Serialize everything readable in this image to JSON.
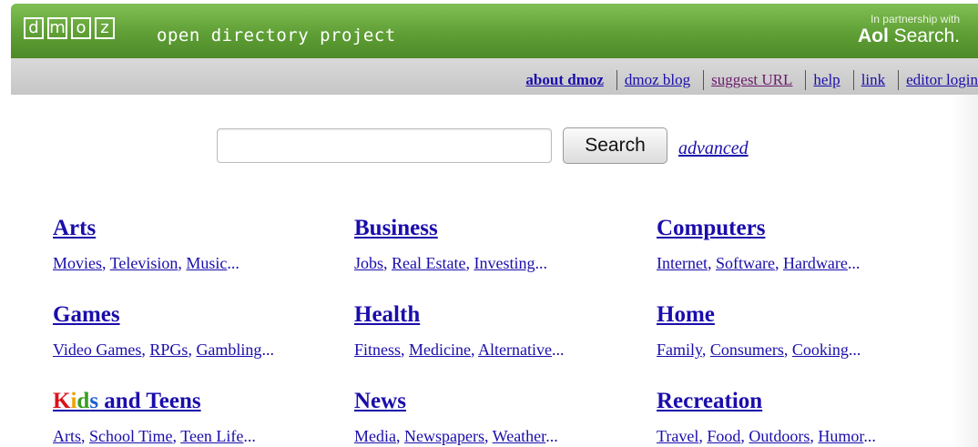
{
  "header": {
    "logo_letters": [
      "d",
      "m",
      "o",
      "z"
    ],
    "tagline": "open directory project",
    "partner_prefix": "In partnership with",
    "partner_brand_bold": "Aol",
    "partner_brand_rest": " Search."
  },
  "nav": {
    "items": [
      {
        "label": "about dmoz"
      },
      {
        "label": "dmoz blog"
      },
      {
        "label": "suggest URL"
      },
      {
        "label": "help"
      },
      {
        "label": "link"
      },
      {
        "label": "editor login"
      }
    ]
  },
  "search": {
    "value": "",
    "button_label": "Search",
    "advanced_label": "advanced"
  },
  "categories": [
    {
      "title": "Arts",
      "subs": [
        "Movies",
        "Television",
        "Music"
      ]
    },
    {
      "title": "Business",
      "subs": [
        "Jobs",
        "Real Estate",
        "Investing"
      ]
    },
    {
      "title": "Computers",
      "subs": [
        "Internet",
        "Software",
        "Hardware"
      ]
    },
    {
      "title": "Games",
      "subs": [
        "Video Games",
        "RPGs",
        "Gambling"
      ]
    },
    {
      "title": "Health",
      "subs": [
        "Fitness",
        "Medicine",
        "Alternative"
      ]
    },
    {
      "title": "Home",
      "subs": [
        "Family",
        "Consumers",
        "Cooking"
      ]
    },
    {
      "title_parts": [
        "K",
        "i",
        "d",
        "s",
        " and Teens"
      ],
      "subs": [
        "Arts",
        "School Time",
        "Teen Life"
      ]
    },
    {
      "title": "News",
      "subs": [
        "Media",
        "Newspapers",
        "Weather"
      ]
    },
    {
      "title": "Recreation",
      "subs": [
        "Travel",
        "Food",
        "Outdoors",
        "Humor"
      ]
    }
  ],
  "colors": {
    "header_green": "#5f9f35",
    "nav_gray": "#cfcfcf",
    "link_blue": "#1a0dab",
    "visited_purple": "#6b1a6b"
  }
}
